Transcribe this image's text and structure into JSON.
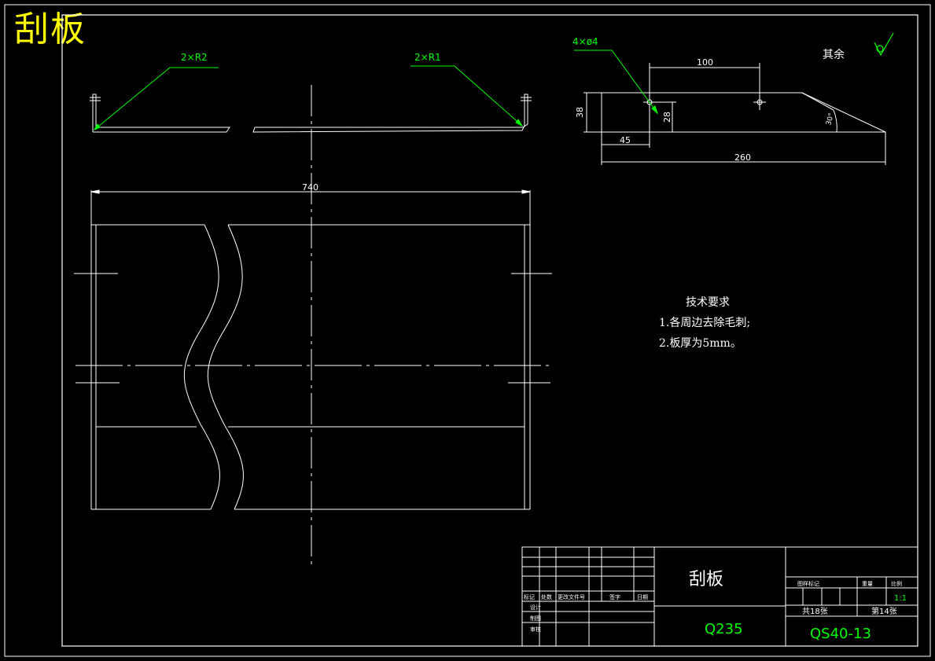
{
  "drawing": {
    "title": "刮板",
    "dimensions": {
      "r2": "2×R2",
      "r1": "2×R1",
      "holes": "4×ø4",
      "d100": "100",
      "d38": "38",
      "d28": "28",
      "d45": "45",
      "d260": "260",
      "d740": "740",
      "angle": "30°"
    },
    "surface_note": "其余"
  },
  "requirements": {
    "heading": "技术要求",
    "items": [
      "1.各周边去除毛刺;",
      "2.板厚为5mm。"
    ]
  },
  "title_block": {
    "part_name": "刮板",
    "material": "Q235",
    "drawing_no": "QS40-13",
    "scale": "1:1",
    "total_sheets_label": "共18张",
    "sheet_label": "第14张",
    "header_labels": [
      "标记",
      "处数",
      "更改文件号",
      "签字",
      "日期"
    ],
    "row_labels": [
      "设计",
      "制图",
      "审核"
    ],
    "right_headers": [
      "图样标记",
      "重量",
      "比例"
    ]
  },
  "colors": {
    "background": "#000000",
    "lines": "#ffffff",
    "dimensions": "#00ff00",
    "title": "#ffff00"
  }
}
